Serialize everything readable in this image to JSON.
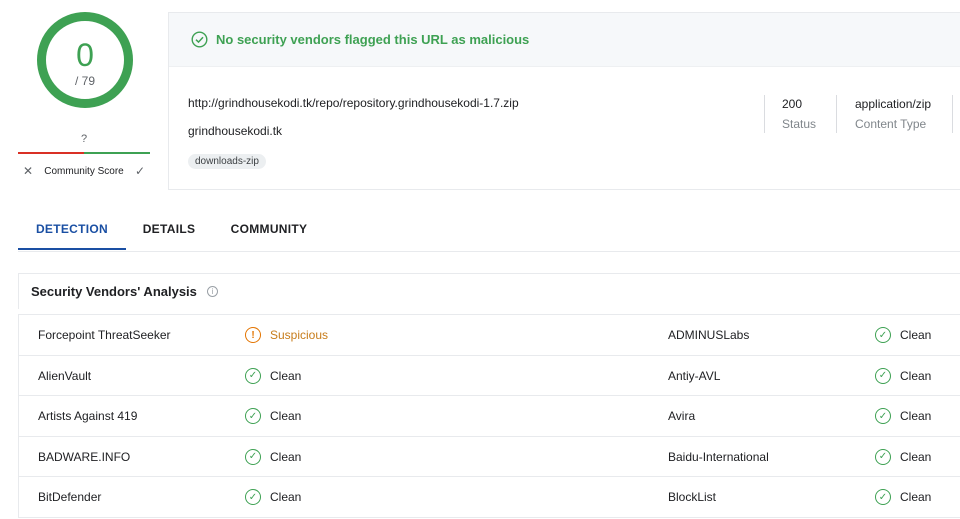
{
  "score": {
    "detections": "0",
    "total": "/ 79"
  },
  "community": {
    "score_value": "?",
    "label": "Community Score",
    "downvote_glyph": "✕",
    "upvote_glyph": "✓"
  },
  "summary": {
    "verdict": "No security vendors flagged this URL as malicious",
    "url": "http://grindhousekodi.tk/repo/repository.grindhousekodi-1.7.zip",
    "domain": "grindhousekodi.tk",
    "tag": "downloads-zip",
    "status_value": "200",
    "status_label": "Status",
    "content_type_value": "application/zip",
    "content_type_label": "Content Type"
  },
  "tabs": [
    {
      "label": "DETECTION",
      "active": true
    },
    {
      "label": "DETAILS",
      "active": false
    },
    {
      "label": "COMMUNITY",
      "active": false
    }
  ],
  "analysis": {
    "title": "Security Vendors' Analysis",
    "rows": [
      {
        "left": {
          "vendor": "Forcepoint ThreatSeeker",
          "result": "Suspicious",
          "status": "suspicious"
        },
        "right": {
          "vendor": "ADMINUSLabs",
          "result": "Clean",
          "status": "clean"
        }
      },
      {
        "left": {
          "vendor": "AlienVault",
          "result": "Clean",
          "status": "clean"
        },
        "right": {
          "vendor": "Antiy-AVL",
          "result": "Clean",
          "status": "clean"
        }
      },
      {
        "left": {
          "vendor": "Artists Against 419",
          "result": "Clean",
          "status": "clean"
        },
        "right": {
          "vendor": "Avira",
          "result": "Clean",
          "status": "clean"
        }
      },
      {
        "left": {
          "vendor": "BADWARE.INFO",
          "result": "Clean",
          "status": "clean"
        },
        "right": {
          "vendor": "Baidu-International",
          "result": "Clean",
          "status": "clean"
        }
      },
      {
        "left": {
          "vendor": "BitDefender",
          "result": "Clean",
          "status": "clean"
        },
        "right": {
          "vendor": "BlockList",
          "result": "Clean",
          "status": "clean"
        }
      }
    ]
  },
  "colors": {
    "clean": "#3ea153",
    "suspicious": "#e37400",
    "malicious": "#d93025",
    "accent": "#1a4fa3"
  },
  "icons": {
    "clean": "check-circle-icon",
    "suspicious": "alert-circle-icon",
    "info": "info-icon"
  }
}
